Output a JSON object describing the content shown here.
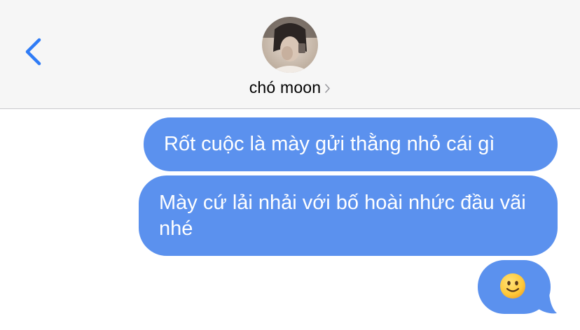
{
  "header": {
    "back_icon": "chevron-left-icon",
    "contact_name": "chó moon",
    "contact_detail_icon": "chevron-right-icon",
    "avatar_icon": "avatar-photo"
  },
  "messages": [
    {
      "direction": "sent",
      "text": "Rốt cuộc là mày gửi thằng nhỏ cái gì"
    },
    {
      "direction": "sent",
      "text": "Mày cứ lải nhải với bố hoài nhức đầu vãi nhé"
    },
    {
      "direction": "sent",
      "emoji": "slightly-smiling-face"
    }
  ],
  "colors": {
    "sent_bubble": "#5b91ee",
    "header_bg": "#f6f6f6",
    "accent": "#2f7cf6"
  }
}
